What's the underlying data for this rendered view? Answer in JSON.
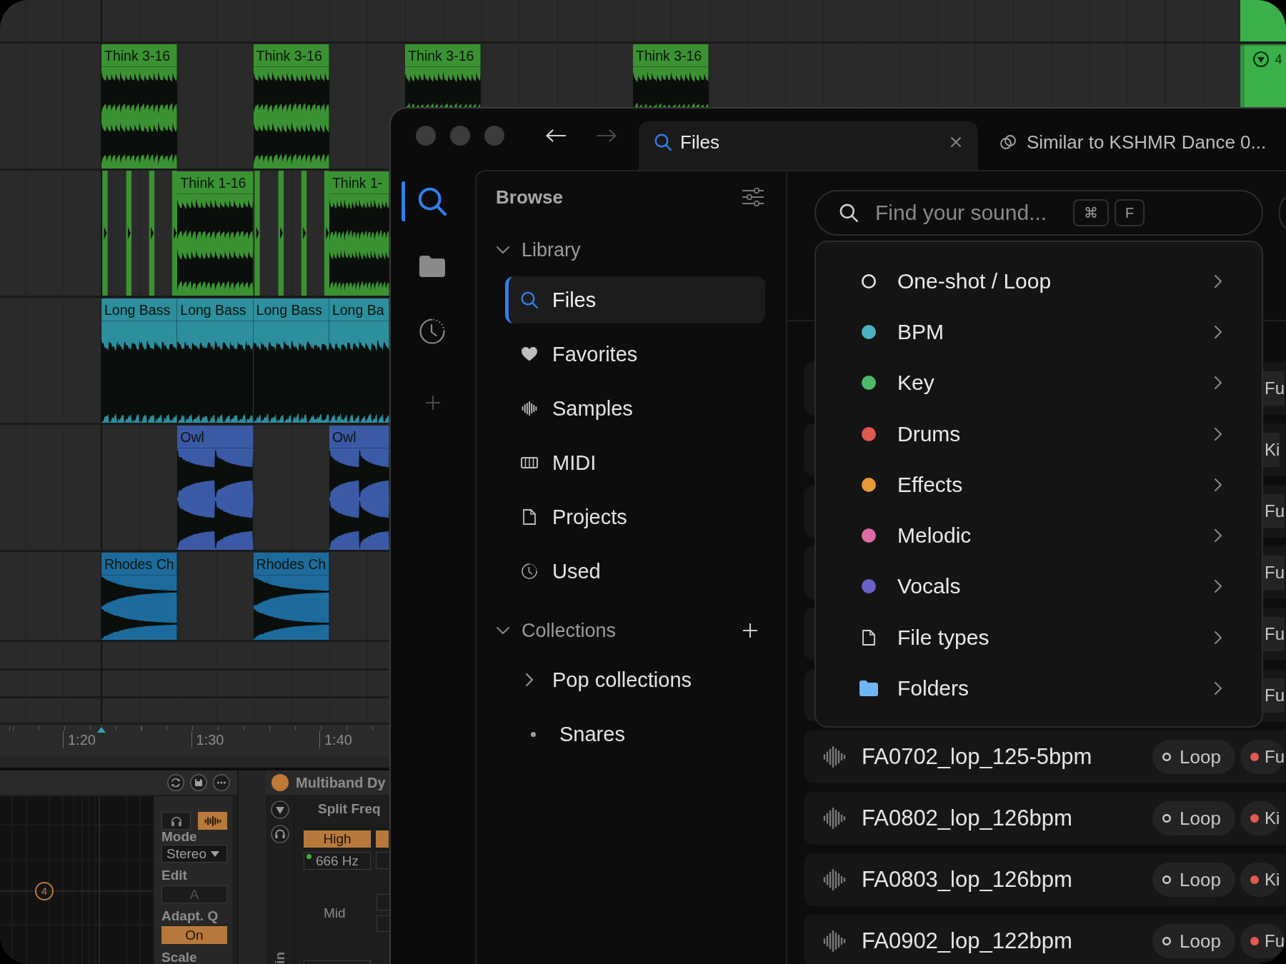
{
  "arrangement": {
    "tracks": [
      {
        "color": "#3bb04a",
        "slots": [
          {
            "kind": "empty"
          },
          {
            "kind": "empty"
          },
          {
            "kind": "empty"
          },
          {
            "kind": "empty"
          },
          {
            "kind": "empty"
          },
          {
            "kind": "empty"
          },
          {
            "kind": "empty"
          },
          {
            "kind": "empty"
          },
          {
            "kind": "empty"
          },
          {
            "kind": "empty"
          },
          {
            "kind": "empty"
          },
          {
            "kind": "empty"
          },
          {
            "kind": "empty"
          },
          {
            "kind": "empty"
          },
          {
            "kind": "empty"
          },
          {
            "kind": "block"
          }
        ]
      },
      {
        "color": "#3b9233",
        "slots": [
          {
            "kind": "clip",
            "name": "Think 3-16"
          },
          {
            "kind": "empty"
          },
          {
            "kind": "clip",
            "name": "Think 3-16"
          },
          {
            "kind": "empty"
          },
          {
            "kind": "clip",
            "name": "Think 3-16"
          },
          {
            "kind": "empty"
          },
          {
            "kind": "empty"
          },
          {
            "kind": "clip",
            "name": "Think 3-16"
          },
          {
            "kind": "empty"
          },
          {
            "kind": "empty"
          },
          {
            "kind": "empty"
          },
          {
            "kind": "empty"
          },
          {
            "kind": "empty"
          },
          {
            "kind": "empty"
          },
          {
            "kind": "empty"
          },
          {
            "kind": "launch",
            "name": "4",
            "color": "#3bb04a"
          }
        ]
      },
      {
        "color": "#3b9233",
        "slots": [
          {
            "kind": "slices"
          },
          {
            "kind": "clip",
            "name": "Think 1-16"
          },
          {
            "kind": "slices"
          },
          {
            "kind": "clip",
            "name": "Think 1-"
          }
        ]
      },
      {
        "color": "#2d8e9d",
        "slots": [
          {
            "kind": "clip",
            "name": "Long Bass"
          },
          {
            "kind": "clip",
            "name": "Long Bass"
          },
          {
            "kind": "clip",
            "name": "Long Bass"
          },
          {
            "kind": "clip",
            "name": "Long Ba"
          }
        ]
      },
      {
        "color": "#3b5aa6",
        "slots": [
          {
            "kind": "empty"
          },
          {
            "kind": "clip",
            "name": "Owl"
          },
          {
            "kind": "empty"
          },
          {
            "kind": "clip",
            "name": "Owl"
          }
        ]
      },
      {
        "color": "#1d6b9c",
        "slots": [
          {
            "kind": "clip",
            "name": "Rhodes Ch"
          },
          {
            "kind": "empty"
          },
          {
            "kind": "clip",
            "name": "Rhodes Ch"
          }
        ]
      }
    ],
    "ruler": [
      "1:20",
      "1:30",
      "1:40"
    ]
  },
  "devices": {
    "eq": {
      "band_marker": "4",
      "spectrum_on": true,
      "params": [
        {
          "kind": "dropdown",
          "label": "Mode",
          "value": "Stereo"
        },
        {
          "kind": "toggle",
          "label": "Edit",
          "value": "A",
          "on": false
        },
        {
          "kind": "toggle",
          "label": "Adapt. Q",
          "value": "On",
          "on": true
        },
        {
          "kind": "heading",
          "label": "Scale"
        }
      ]
    },
    "multiband": {
      "title": "Multiband Dy",
      "on": true,
      "section": "Split Freq",
      "band": {
        "label": "High",
        "on": true
      },
      "frequency": "666 Hz",
      "row_label": "Mid",
      "side_label": "in"
    }
  },
  "browser_window": {
    "navigation": {
      "back_disabled": false,
      "forward_disabled": true
    },
    "tabs": [
      {
        "label": "Files",
        "selected": true
      },
      {
        "label": "Similar to KSHMR Dance 0...",
        "selected": false
      }
    ],
    "rail": {
      "items": [
        {
          "selected": true
        },
        {
          "selected": false
        },
        {
          "selected": false
        }
      ]
    },
    "browse": {
      "title": "Browse",
      "sections": [
        {
          "label": "Library",
          "expanded": true,
          "items": [
            {
              "label": "Files",
              "selected": true
            },
            {
              "label": "Favorites",
              "selected": false
            },
            {
              "label": "Samples",
              "selected": false
            },
            {
              "label": "MIDI",
              "selected": false
            },
            {
              "label": "Projects",
              "selected": false
            },
            {
              "label": "Used",
              "selected": false
            }
          ]
        },
        {
          "label": "Collections",
          "expanded": true,
          "addable": true,
          "items": [
            {
              "kind": "group",
              "label": "Pop collections",
              "expanded": false,
              "selected": false
            },
            {
              "kind": "collection",
              "label": "Snares",
              "selected": false
            }
          ]
        }
      ]
    },
    "search": {
      "placeholder": "Find your sound...",
      "shortcut": [
        "⌘",
        "F"
      ]
    },
    "filter_menu": {
      "items": [
        {
          "kind": "ring",
          "label": "One-shot / Loop",
          "submenu": true
        },
        {
          "kind": "dot",
          "label": "BPM",
          "color": "#4cb0c4",
          "submenu": true
        },
        {
          "kind": "dot",
          "label": "Key",
          "color": "#4dba6a",
          "submenu": true
        },
        {
          "kind": "dot",
          "label": "Drums",
          "color": "#e05a50",
          "submenu": true
        },
        {
          "kind": "dot",
          "label": "Effects",
          "color": "#e59a35",
          "submenu": true
        },
        {
          "kind": "dot",
          "label": "Melodic",
          "color": "#e06aa4",
          "submenu": true
        },
        {
          "kind": "dot",
          "label": "Vocals",
          "color": "#6b62cc",
          "submenu": true
        },
        {
          "kind": "file",
          "label": "File types",
          "submenu": true
        },
        {
          "kind": "folder",
          "label": "Folders",
          "submenu": true
        }
      ]
    },
    "results": [
      {
        "tags": [
          {
            "kind": "category",
            "label": "Fu"
          }
        ]
      },
      {
        "tags": [
          {
            "kind": "category",
            "label": "Ki"
          }
        ]
      },
      {
        "tags": [
          {
            "kind": "category",
            "label": "Fu"
          }
        ]
      },
      {
        "tags": [
          {
            "kind": "category",
            "label": "Fu"
          }
        ]
      },
      {
        "tags": [
          {
            "kind": "category",
            "label": "Fu"
          }
        ]
      },
      {
        "tags": [
          {
            "kind": "category",
            "label": "Fu"
          }
        ]
      },
      {
        "name": "FA0702_lop_125-5bpm",
        "tags": [
          {
            "kind": "type",
            "label": "Loop"
          },
          {
            "kind": "category",
            "label": "Fu",
            "color": "#e05a50"
          }
        ]
      },
      {
        "name": "FA0802_lop_126bpm",
        "tags": [
          {
            "kind": "type",
            "label": "Loop"
          },
          {
            "kind": "category",
            "label": "Ki",
            "color": "#e05a50"
          }
        ]
      },
      {
        "name": "FA0803_lop_126bpm",
        "tags": [
          {
            "kind": "type",
            "label": "Loop"
          },
          {
            "kind": "category",
            "label": "Ki",
            "color": "#e05a50"
          }
        ]
      },
      {
        "name": "FA0902_lop_122bpm",
        "tags": [
          {
            "kind": "type",
            "label": "Loop"
          },
          {
            "kind": "category",
            "label": "Fu",
            "color": "#e05a50"
          }
        ]
      }
    ]
  }
}
